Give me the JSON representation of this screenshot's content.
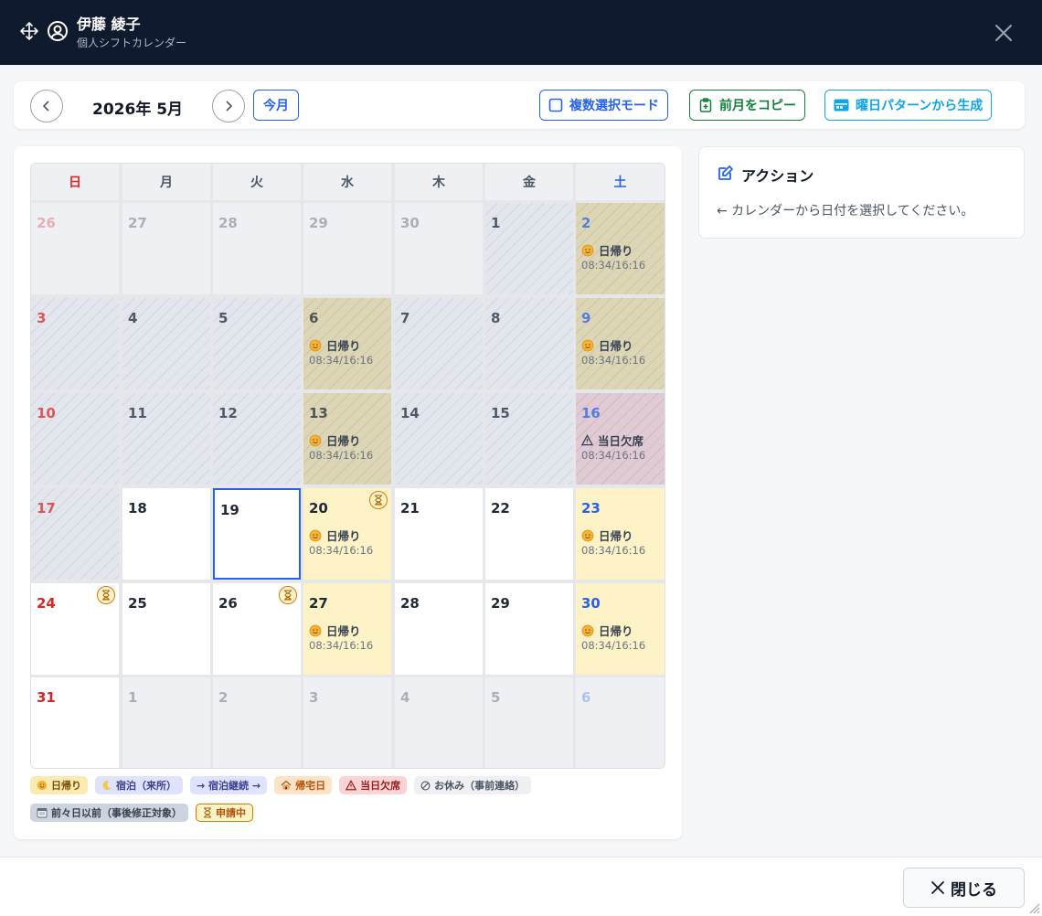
{
  "header": {
    "name": "伊藤 綾子",
    "subtitle": "個人シフトカレンダー"
  },
  "toolbar": {
    "month_label": "2026年 5月",
    "today_label": "今月",
    "multi_select_label": "複数選択モード",
    "copy_prev_label": "前月をコピー",
    "pattern_label": "曜日パターンから生成"
  },
  "calendar": {
    "weekdays": [
      "日",
      "月",
      "火",
      "水",
      "木",
      "金",
      "土"
    ],
    "days": [
      {
        "day": "26",
        "state": "other"
      },
      {
        "day": "27",
        "state": "other"
      },
      {
        "day": "28",
        "state": "other"
      },
      {
        "day": "29",
        "state": "other"
      },
      {
        "day": "30",
        "state": "other"
      },
      {
        "day": "1",
        "state": "past"
      },
      {
        "day": "2",
        "state": "dayt-past",
        "event": "日帰り",
        "time": "08:34/16:16"
      },
      {
        "day": "3",
        "state": "past"
      },
      {
        "day": "4",
        "state": "past"
      },
      {
        "day": "5",
        "state": "past"
      },
      {
        "day": "6",
        "state": "dayt-past",
        "event": "日帰り",
        "time": "08:34/16:16"
      },
      {
        "day": "7",
        "state": "past"
      },
      {
        "day": "8",
        "state": "past"
      },
      {
        "day": "9",
        "state": "dayt-past",
        "event": "日帰り",
        "time": "08:34/16:16"
      },
      {
        "day": "10",
        "state": "past"
      },
      {
        "day": "11",
        "state": "past"
      },
      {
        "day": "12",
        "state": "past"
      },
      {
        "day": "13",
        "state": "dayt-past",
        "event": "日帰り",
        "time": "08:34/16:16"
      },
      {
        "day": "14",
        "state": "past"
      },
      {
        "day": "15",
        "state": "past"
      },
      {
        "day": "16",
        "state": "absent-past",
        "event": "当日欠席",
        "time": "08:34/16:16"
      },
      {
        "day": "17",
        "state": "past"
      },
      {
        "day": "18",
        "state": "normal"
      },
      {
        "day": "19",
        "state": "selected"
      },
      {
        "day": "20",
        "state": "dayt",
        "event": "日帰り",
        "time": "08:34/16:16",
        "pending": true
      },
      {
        "day": "21",
        "state": "normal"
      },
      {
        "day": "22",
        "state": "normal"
      },
      {
        "day": "23",
        "state": "dayt",
        "event": "日帰り",
        "time": "08:34/16:16"
      },
      {
        "day": "24",
        "state": "normal",
        "pending": true
      },
      {
        "day": "25",
        "state": "normal"
      },
      {
        "day": "26",
        "state": "normal",
        "pending": true
      },
      {
        "day": "27",
        "state": "dayt",
        "event": "日帰り",
        "time": "08:34/16:16"
      },
      {
        "day": "28",
        "state": "normal"
      },
      {
        "day": "29",
        "state": "normal"
      },
      {
        "day": "30",
        "state": "dayt",
        "event": "日帰り",
        "time": "08:34/16:16"
      },
      {
        "day": "31",
        "state": "normal"
      },
      {
        "day": "1",
        "state": "other"
      },
      {
        "day": "2",
        "state": "other"
      },
      {
        "day": "3",
        "state": "other"
      },
      {
        "day": "4",
        "state": "other"
      },
      {
        "day": "5",
        "state": "other"
      },
      {
        "day": "6",
        "state": "other"
      }
    ]
  },
  "legend": {
    "row1": [
      {
        "label": "日帰り",
        "icon": "sun-face-icon",
        "bg": "#fdeab0",
        "fg": "#7a4f0c"
      },
      {
        "label": "宿泊（来所）",
        "icon": "moon-icon",
        "bg": "#dfe3fb",
        "fg": "#3c3f8f"
      },
      {
        "label": "→ 宿泊継続 →",
        "icon": "",
        "bg": "#dfe3fb",
        "fg": "#3c3f8f"
      },
      {
        "label": "帰宅日",
        "icon": "house-icon",
        "bg": "#fde3c7",
        "fg": "#b45309"
      },
      {
        "label": "当日欠席",
        "icon": "warning-icon",
        "bg": "#fbd5d5",
        "fg": "#9b1c1c"
      },
      {
        "label": "お休み（事前連絡）",
        "icon": "no-icon",
        "bg": "#eef0f3",
        "fg": "#4b5563"
      }
    ],
    "row2": [
      {
        "label": "前々日以前（事後修正対象）",
        "icon": "calendar-icon",
        "bg": "#cdd4de",
        "fg": "#374151"
      },
      {
        "label": "申請中",
        "icon": "hourglass-icon",
        "bg": "#fef3c7",
        "fg": "#b45309",
        "border": "#d97706"
      }
    ]
  },
  "action": {
    "title": "アクション",
    "message": "← カレンダーから日付を選択してください。"
  },
  "footer": {
    "close_label": "閉じる"
  },
  "colors": {
    "accent": "#2563eb",
    "green": "#15803d",
    "cyan": "#0ea5e9",
    "header_bg": "#101a2e"
  }
}
